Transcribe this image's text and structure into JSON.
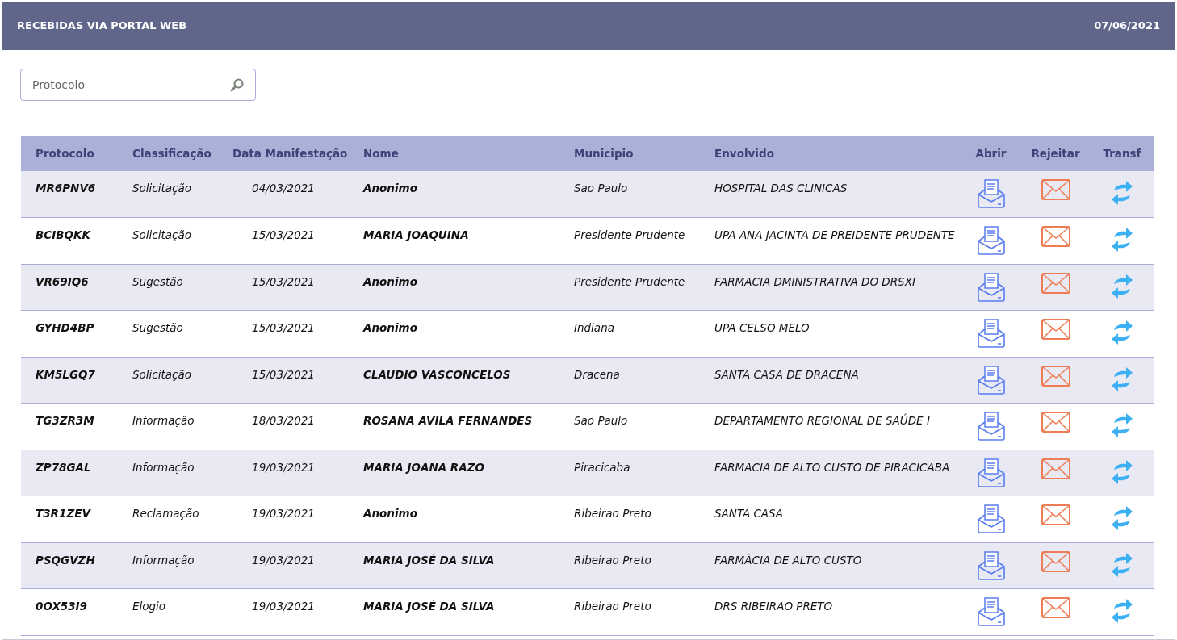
{
  "header": {
    "title": "RECEBIDAS VIA PORTAL WEB",
    "date": "07/06/2021"
  },
  "search": {
    "placeholder": "Protocolo"
  },
  "table": {
    "columns": [
      "Protocolo",
      "Classificação",
      "Data Manifestação",
      "Nome",
      "Municipio",
      "Envolvido",
      "Abrir",
      "Rejeitar",
      "Transf"
    ],
    "rows": [
      {
        "protocolo": "MR6PNV6",
        "classificacao": "Solicitação",
        "data": "04/03/2021",
        "nome": "Anonimo",
        "municipio": "Sao Paulo",
        "envolvido": "HOSPITAL DAS CLINICAS"
      },
      {
        "protocolo": "BCIBQKK",
        "classificacao": "Solicitação",
        "data": "15/03/2021",
        "nome": "MARIA JOAQUINA",
        "municipio": "Presidente Prudente",
        "envolvido": "UPA ANA JACINTA DE PREIDENTE PRUDENTE"
      },
      {
        "protocolo": "VR69IQ6",
        "classificacao": "Sugestão",
        "data": "15/03/2021",
        "nome": "Anonimo",
        "municipio": "Presidente Prudente",
        "envolvido": "FARMACIA DMINISTRATIVA DO DRSXI"
      },
      {
        "protocolo": "GYHD4BP",
        "classificacao": "Sugestão",
        "data": "15/03/2021",
        "nome": "Anonimo",
        "municipio": "Indiana",
        "envolvido": "UPA CELSO MELO"
      },
      {
        "protocolo": "KM5LGQ7",
        "classificacao": "Solicitação",
        "data": "15/03/2021",
        "nome": "CLAUDIO VASCONCELOS",
        "municipio": "Dracena",
        "envolvido": "SANTA CASA DE DRACENA"
      },
      {
        "protocolo": "TG3ZR3M",
        "classificacao": "Informação",
        "data": "18/03/2021",
        "nome": "ROSANA AVILA FERNANDES",
        "municipio": "Sao Paulo",
        "envolvido": "DEPARTAMENTO REGIONAL DE SAÚDE I"
      },
      {
        "protocolo": "ZP78GAL",
        "classificacao": "Informação",
        "data": "19/03/2021",
        "nome": "MARIA JOANA RAZO",
        "municipio": "Piracicaba",
        "envolvido": "FARMACIA DE ALTO CUSTO DE PIRACICABA"
      },
      {
        "protocolo": "T3R1ZEV",
        "classificacao": "Reclamação",
        "data": "19/03/2021",
        "nome": "Anonimo",
        "municipio": "Ribeirao Preto",
        "envolvido": "SANTA CASA"
      },
      {
        "protocolo": "PSQGVZH",
        "classificacao": "Informação",
        "data": "19/03/2021",
        "nome": "MARIA JOSÉ DA SILVA",
        "municipio": "Ribeirao Preto",
        "envolvido": "FARMÁCIA DE ALTO CUSTO"
      },
      {
        "protocolo": "0OX53I9",
        "classificacao": "Elogio",
        "data": "19/03/2021",
        "nome": "MARIA JOSÉ DA SILVA",
        "municipio": "Ribeirao Preto",
        "envolvido": "DRS RIBEIRÃO PRETO"
      }
    ]
  }
}
